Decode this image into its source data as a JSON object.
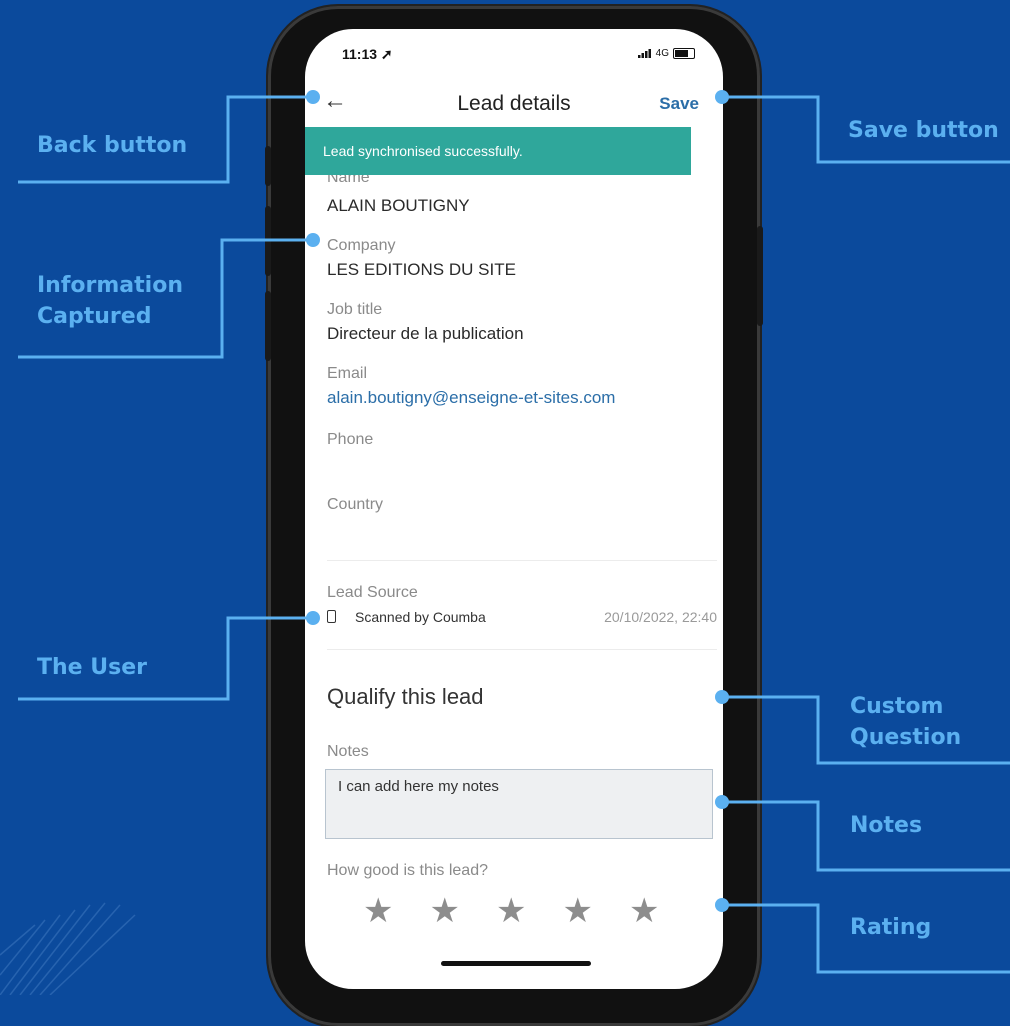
{
  "callouts": {
    "back": "Back button",
    "info": "Information\nCaptured",
    "user": "The User",
    "save": "Save button",
    "custom": "Custom\nQuestion",
    "notes": "Notes",
    "rating": "Rating"
  },
  "status": {
    "time": "11:13",
    "network": "4G"
  },
  "header": {
    "title": "Lead details",
    "save_label": "Save"
  },
  "toast": "Lead synchronised successfully.",
  "fields": {
    "name_label": "Name",
    "name_value": "ALAIN BOUTIGNY",
    "company_label": "Company",
    "company_value": "LES EDITIONS DU SITE",
    "job_label": "Job title",
    "job_value": "Directeur de la publication",
    "email_label": "Email",
    "email_value": "alain.boutigny@enseigne-et-sites.com",
    "phone_label": "Phone",
    "country_label": "Country"
  },
  "lead_source": {
    "label": "Lead Source",
    "text": "Scanned by Coumba",
    "date": "20/10/2022, 22:40"
  },
  "qualify": {
    "title": "Qualify this lead",
    "notes_label": "Notes",
    "notes_value": "I can add here my notes",
    "rating_label": "How good is this lead?",
    "rating": 0,
    "rating_max": 5
  },
  "colors": {
    "background": "#0b4a9c",
    "callout": "#5bb0f0",
    "toast": "#2fa79b",
    "link": "#2b6ea8"
  }
}
